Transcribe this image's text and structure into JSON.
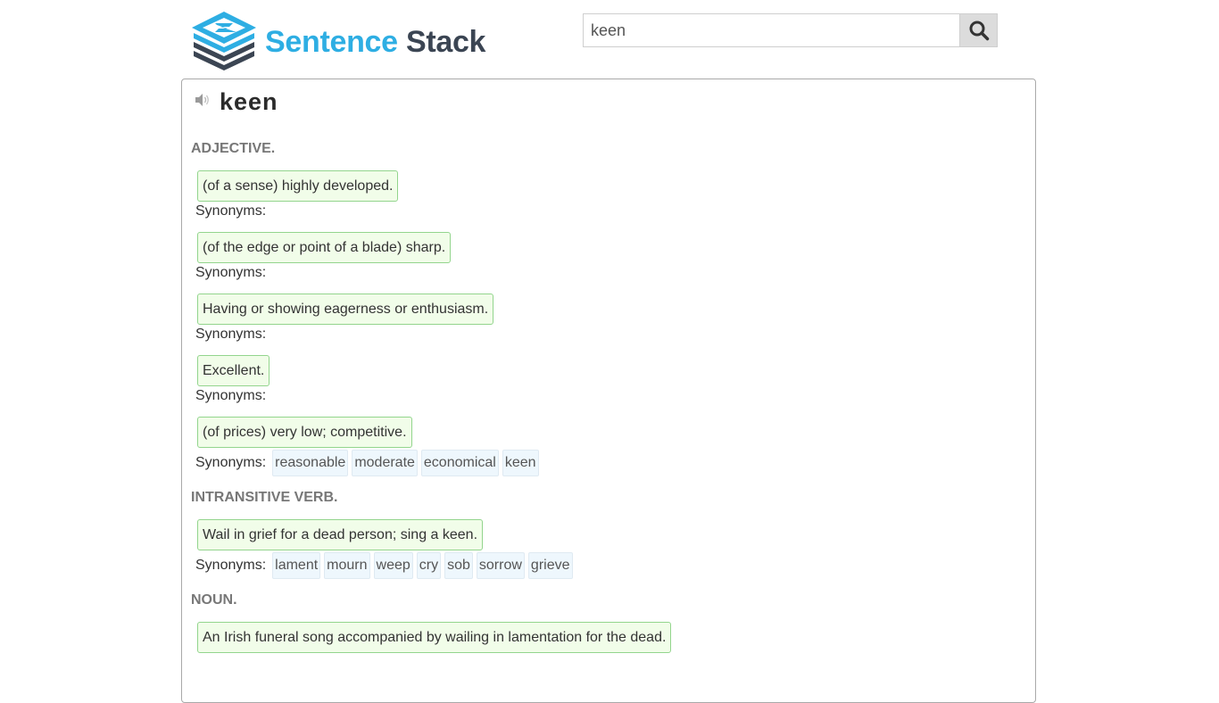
{
  "header": {
    "logo_icon": "stacked-layers-s-logo",
    "brand_part1": "Sentence",
    "brand_part2": "Stack",
    "colors": {
      "brand_blue": "#2eaee3",
      "brand_dark": "#3b4553"
    }
  },
  "search": {
    "value": "keen",
    "placeholder": "",
    "button_icon": "search-icon"
  },
  "entry": {
    "word": "keen",
    "audio_icon": "speaker-icon",
    "synonyms_label": "Synonyms:",
    "groups": [
      {
        "pos": "ADJECTIVE.",
        "senses": [
          {
            "definition": "(of a sense) highly developed.",
            "synonyms": []
          },
          {
            "definition": "(of the edge or point of a blade) sharp.",
            "synonyms": []
          },
          {
            "definition": "Having or showing eagerness or enthusiasm.",
            "synonyms": []
          },
          {
            "definition": "Excellent.",
            "synonyms": []
          },
          {
            "definition": "(of prices) very low; competitive.",
            "synonyms": [
              "reasonable",
              "moderate",
              "economical",
              "keen"
            ]
          }
        ]
      },
      {
        "pos": "INTRANSITIVE VERB.",
        "senses": [
          {
            "definition": "Wail in grief for a dead person; sing a keen.",
            "synonyms": [
              "lament",
              "mourn",
              "weep",
              "cry",
              "sob",
              "sorrow",
              "grieve"
            ]
          }
        ]
      },
      {
        "pos": "NOUN.",
        "senses": [
          {
            "definition": "An Irish funeral song accompanied by wailing in lamentation for the dead.",
            "synonyms": []
          }
        ]
      }
    ]
  },
  "colors": {
    "definition_bg": "#f1fde9",
    "definition_border": "#93d58d",
    "synonym_bg": "#eef7fd",
    "pos_label": "#777777"
  }
}
